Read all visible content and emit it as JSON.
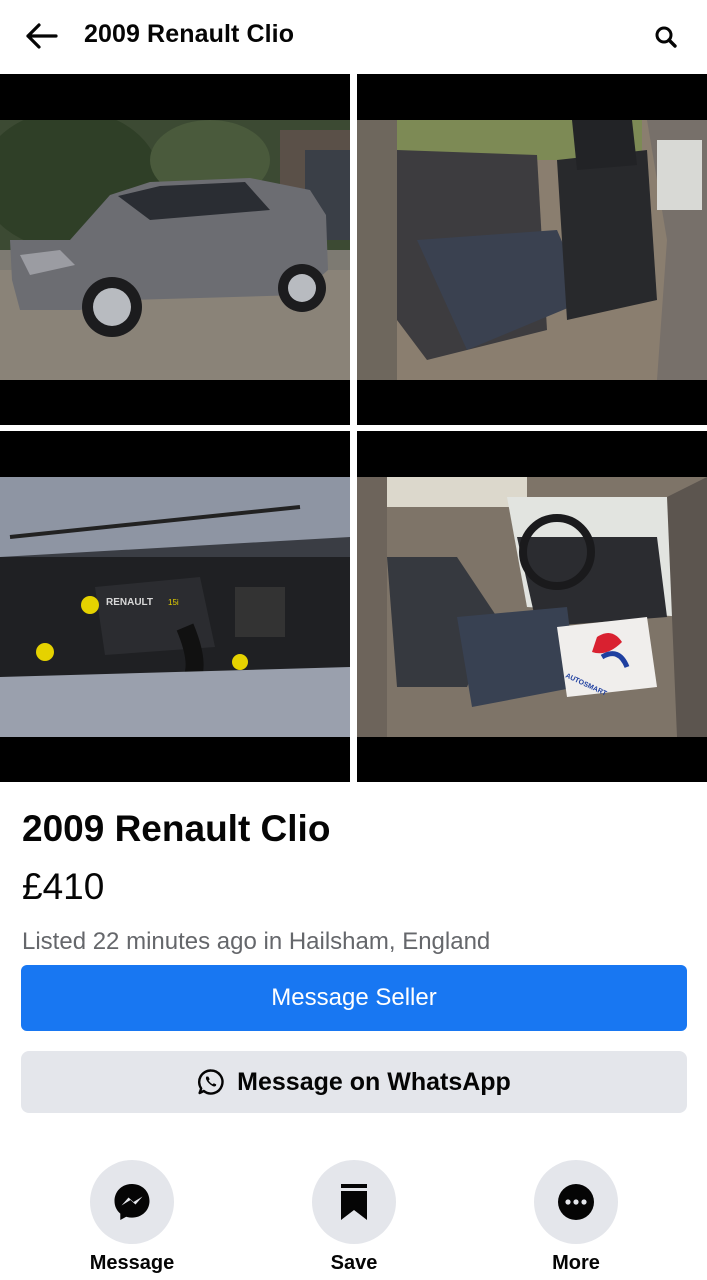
{
  "header": {
    "title": "2009 Renault Clio",
    "back_icon": "arrow-left-icon",
    "search_icon": "search-icon"
  },
  "gallery": {
    "photos": [
      {
        "subject": "car-exterior"
      },
      {
        "subject": "rear-seats"
      },
      {
        "subject": "engine-bay"
      },
      {
        "subject": "front-interior"
      }
    ],
    "engine_badge": "RENAULT",
    "engine_badge_sub": "15i",
    "mat_text": "AUTOSMART"
  },
  "listing": {
    "title": "2009 Renault Clio",
    "price": "£410",
    "meta": "Listed 22 minutes ago in Hailsham, England"
  },
  "buttons": {
    "message_seller": "Message Seller",
    "whatsapp": "Message on WhatsApp"
  },
  "actions": [
    {
      "label": "Message",
      "icon": "messenger-icon"
    },
    {
      "label": "Save",
      "icon": "bookmark-icon"
    },
    {
      "label": "More",
      "icon": "more-dots-icon"
    }
  ],
  "colors": {
    "primary": "#1877f2",
    "secondary_bg": "#e4e6eb",
    "muted_text": "#65676b"
  }
}
